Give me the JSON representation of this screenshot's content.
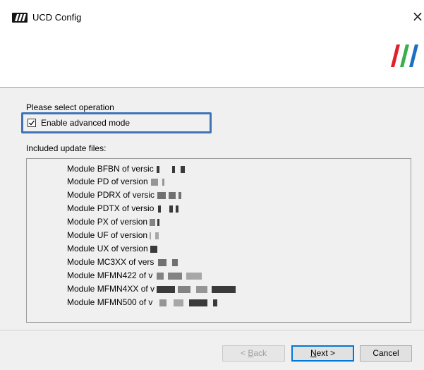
{
  "window": {
    "title": "UCD Config",
    "close_glyph": "×"
  },
  "content": {
    "operation_label": "Please select operation",
    "advanced_mode": {
      "label": "Enable advanced mode",
      "checked": true
    },
    "files_label": "Included update files:",
    "files": [
      "Module BFBN of versic",
      "Module PD of version",
      "Module PDRX of versic",
      "Module PDTX of versio",
      "Module PX of version",
      "Module UF of version",
      "Module UX of version",
      "Module MC3XX of vers",
      "Module MFMN422 of v",
      "Module MFMN4XX of v",
      "Module MFMN500 of v"
    ]
  },
  "buttons": {
    "back": {
      "prefix": "< ",
      "mnemonic": "B",
      "rest": "ack",
      "enabled": false
    },
    "next": {
      "mnemonic": "N",
      "rest": "ext >",
      "enabled": true
    },
    "cancel": {
      "label": "Cancel",
      "enabled": true
    }
  },
  "colors": {
    "highlight_border": "#3f74b7",
    "logo_red": "#e3202a",
    "logo_green": "#3aae49",
    "logo_blue": "#1f6fc1"
  }
}
